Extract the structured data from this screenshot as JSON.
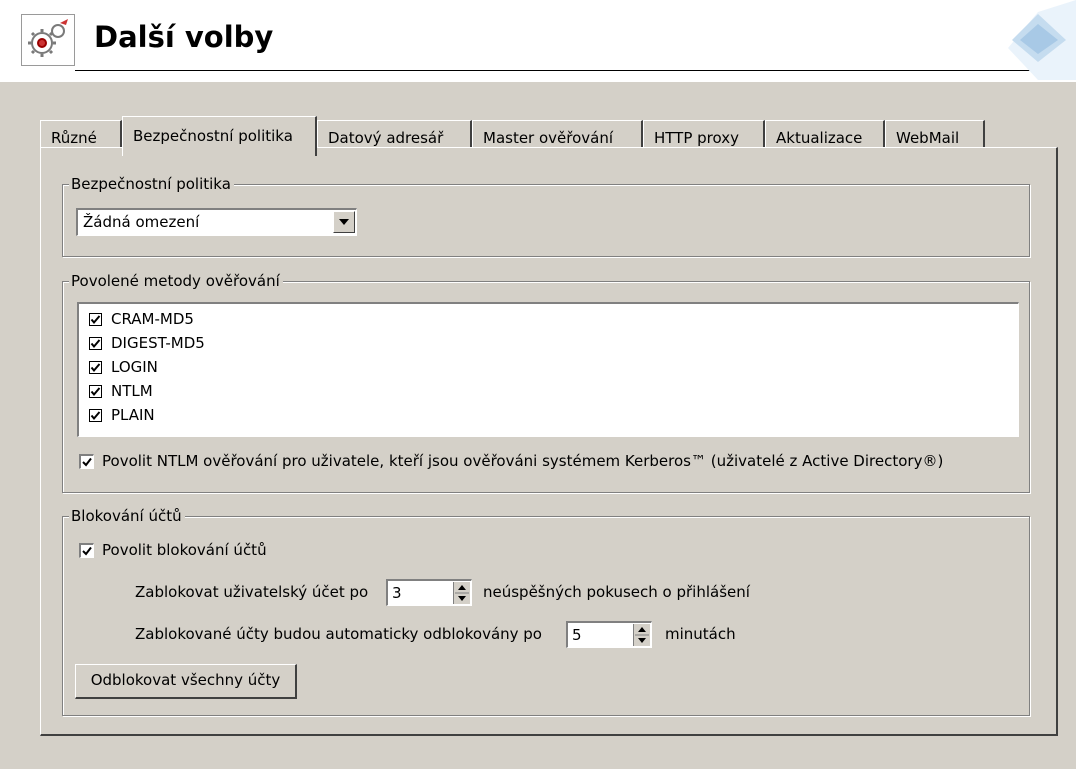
{
  "header": {
    "title": "Další volby"
  },
  "tabs": [
    {
      "label": "Různé"
    },
    {
      "label": "Bezpečnostní politika"
    },
    {
      "label": "Datový adresář"
    },
    {
      "label": "Master ověřování"
    },
    {
      "label": "HTTP proxy"
    },
    {
      "label": "Aktualizace"
    },
    {
      "label": "WebMail"
    }
  ],
  "security_policy": {
    "legend": "Bezpečnostní politika",
    "selected": "Žádná omezení"
  },
  "auth_methods": {
    "legend": "Povolené metody ověřování",
    "items": [
      {
        "label": "CRAM-MD5",
        "checked": true
      },
      {
        "label": "DIGEST-MD5",
        "checked": true
      },
      {
        "label": "LOGIN",
        "checked": true
      },
      {
        "label": "NTLM",
        "checked": true
      },
      {
        "label": "PLAIN",
        "checked": true
      }
    ],
    "ntlm_option": "Povolit NTLM ověřování pro uživatele, kteří jsou ověřováni systémem Kerberos™ (uživatelé z Active Directory®)"
  },
  "account_lock": {
    "legend": "Blokování účtů",
    "enable_label": "Povolit blokování účtů",
    "lock_after_label": "Zablokovat uživatelský účet po",
    "lock_after_value": "3",
    "lock_after_suffix": "neúspěšných pokusech o přihlášení",
    "unlock_after_label": "Zablokované účty budou automaticky odblokovány po",
    "unlock_after_value": "5",
    "unlock_after_suffix": "minutách",
    "unlock_all_button": "Odblokovat všechny účty"
  }
}
